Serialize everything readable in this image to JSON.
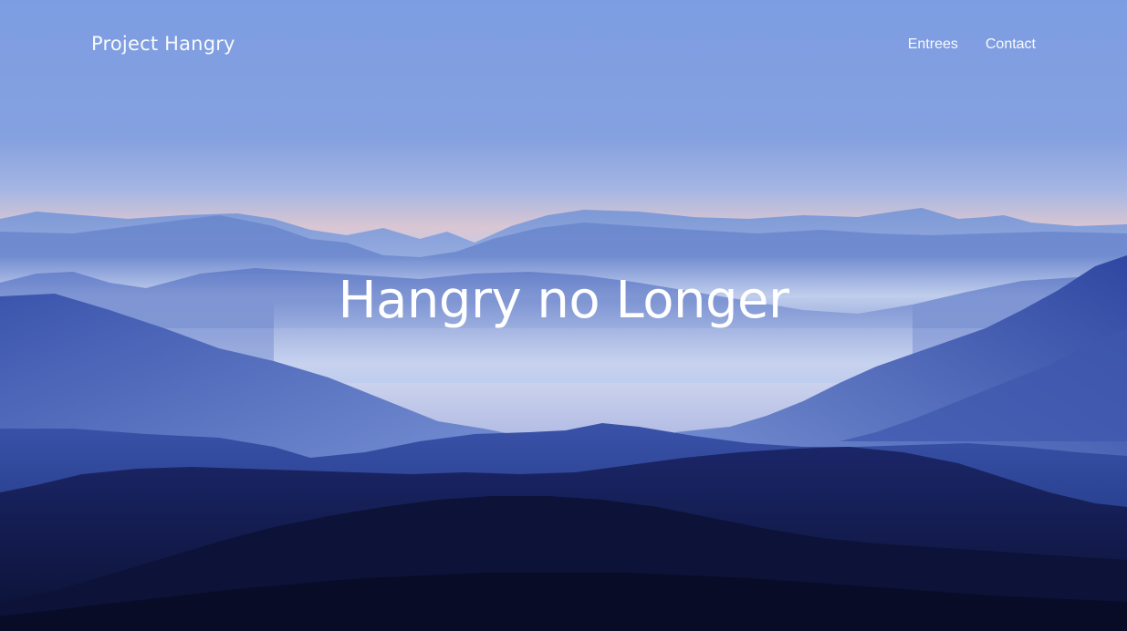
{
  "navbar": {
    "brand": "Project Hangry",
    "links": [
      {
        "label": "Entrees"
      },
      {
        "label": "Contact"
      }
    ]
  },
  "hero": {
    "headline": "Hangry no Longer"
  },
  "colors": {
    "sky_top": "#7f9fe4",
    "sky_horizon": "#b3c0e4",
    "horizon_glow": "#e8c9c8",
    "mountain_far": "#6f8ed2",
    "mountain_mid": "#4f68b8",
    "mountain_near": "#23306f",
    "mountain_front": "#0d1433",
    "text": "#ffffff"
  }
}
